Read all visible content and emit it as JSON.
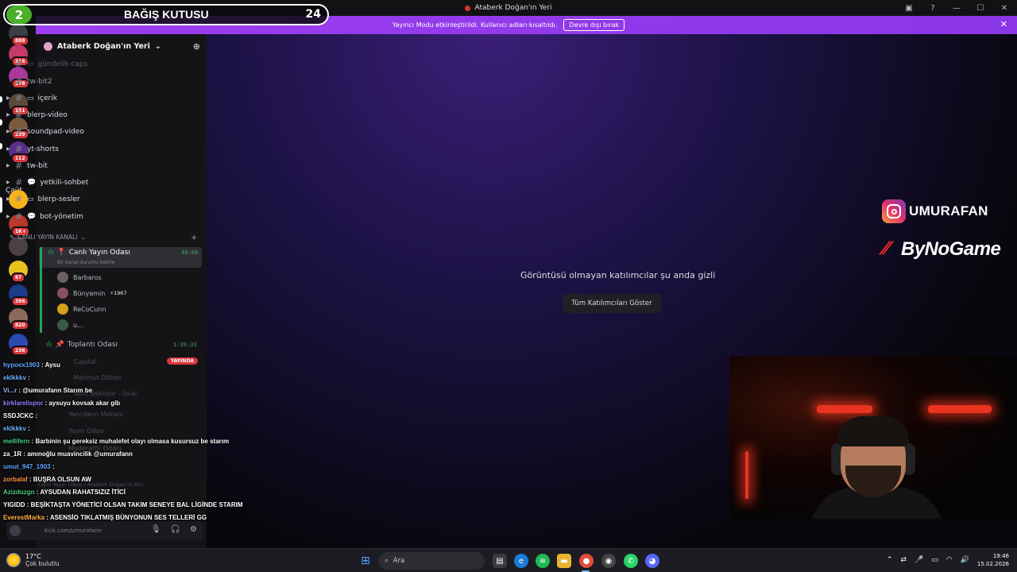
{
  "window": {
    "title": "Ataberk Doğan'ın Yeri"
  },
  "notice": {
    "text": "Yayıncı Modu etkinleştirildi. Kullanıcı adları kısaltıldı.",
    "button": "Devre dışı bırak"
  },
  "donation": {
    "badge": "2",
    "title": "BAĞIŞ KUTUSU",
    "count": "24"
  },
  "rail": {
    "label": "Çaüt",
    "badges": [
      "888",
      "216",
      "278",
      "151",
      "239",
      "112",
      "1K+",
      "87",
      "396",
      "820",
      "236"
    ]
  },
  "server": {
    "name": "Ataberk Doğan'ın Yeri",
    "channels": [
      {
        "name": "gündelik-caps",
        "prefix": "▭",
        "state": "dim"
      },
      {
        "name": "tw-bit2",
        "prefix": "",
        "state": "normal"
      },
      {
        "name": "içerik",
        "prefix": "▭",
        "state": "bright"
      },
      {
        "name": "blerp-video",
        "prefix": "",
        "state": "bright"
      },
      {
        "name": "soundpad-video",
        "prefix": "",
        "state": "bright"
      },
      {
        "name": "yt-shorts",
        "prefix": "",
        "state": "bright"
      },
      {
        "name": "tw-bit",
        "prefix": "",
        "state": "bright"
      },
      {
        "name": "yetkili-sohbet",
        "prefix": "💬",
        "state": "bright"
      },
      {
        "name": "blerp-sesler",
        "prefix": "▭",
        "state": "bright"
      },
      {
        "name": "bot-yönetim",
        "prefix": "💬",
        "state": "bright"
      }
    ],
    "category": "CANLI YAYIN KANALI",
    "voice_channel": {
      "name": "Canlı Yayın Odası",
      "status": "Bir kanal durumu belirle",
      "timer": "48:08",
      "members": [
        "Barbaros",
        "Bünyamin",
        "ReCoCunn",
        "u..."
      ],
      "member_tag": "1967"
    },
    "voice_channel2": {
      "name": "Toplantı Odası",
      "timer": "1:39:33",
      "live": "YAYINDA"
    },
    "ghost_items": [
      "Capital",
      "Mahmut Dilben",
      "Yanıt Bekliyor - Ünal",
      "Yancıların Mekanı",
      "Yayın Odası",
      "Moderatör Odası",
      "Canlı Yayın Odası / Ataberk Doğan'ın Yeri"
    ]
  },
  "stage": {
    "message": "Görüntüsü olmayan katılımcılar şu anda gizli",
    "button": "Tüm Katılımcıları Göster"
  },
  "overlay": {
    "instagram": "UMURAFAN",
    "sponsor": "ByNoGame"
  },
  "chat": [
    {
      "user": "hypoex1903",
      "color": "#5ea7ff",
      "msg": "Aysu"
    },
    {
      "user": "eklkkkv",
      "color": "#6fb0ff",
      "msg": ""
    },
    {
      "user": "Vi...r",
      "color": "#9ab7ff",
      "msg": "@umurafann Starım be"
    },
    {
      "user": "kirklarelispor",
      "color": "#9a7cff",
      "msg": "aysuyu kovsak akar gib"
    },
    {
      "user": "SSDJCKC",
      "color": "#ffffff",
      "msg": ""
    },
    {
      "user": "eklkkkv",
      "color": "#6fb0ff",
      "msg": ""
    },
    {
      "user": "mellifern",
      "color": "#4fd07c",
      "msg": "Barbinin şu gereksiz muhalefet olayı olmasa kusursuz be starım"
    },
    {
      "user": "za_1R",
      "color": "#ffffff",
      "msg": "amınoğlu muavincilik @umurafann"
    },
    {
      "user": "umut_947_1903",
      "color": "#5ea7ff",
      "msg": ""
    },
    {
      "user": "zorbalaf",
      "color": "#ff9a3c",
      "msg": "BUŞRA OLSUN AW"
    },
    {
      "user": "Azizduzgn",
      "color": "#4fd07c",
      "msg": "AYSUDAN RAHATSIZIZ İTİCİ"
    },
    {
      "user": "YIGIDD",
      "color": "#ffffff",
      "msg": "BEŞİKTAŞTA YÖNETİCİ OLSAN TAKIM SENEYE BAL LİGİNDE STARIM"
    },
    {
      "user": "EverestMarka",
      "color": "#ffb347",
      "msg": "ASENSİO TIKLATMIŞ BÜNYONUN SES TELLERİ GG"
    }
  ],
  "user_panel": {
    "text": "kick.com/umurafann"
  },
  "taskbar": {
    "temp": "17°C",
    "weather": "Çok bulutlu",
    "search": "Ara",
    "time": "19:46",
    "date": "15.02.2026"
  },
  "colors": {
    "accent": "#9b3ef0",
    "online": "#23a55a",
    "badge": "#da373c"
  }
}
